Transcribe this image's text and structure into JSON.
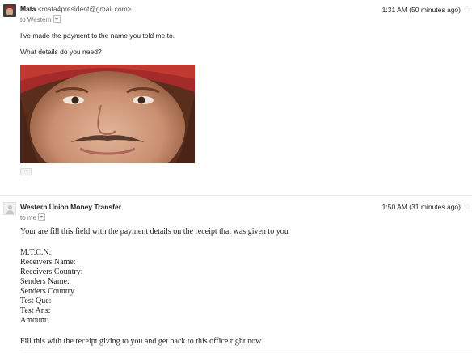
{
  "message1": {
    "sender_name": "Mata",
    "sender_email": "<mata4president@gmail.com>",
    "recipient": "to Western",
    "time": "1:31 AM (50 minutes ago)",
    "line1": "I've made the payment to the name you told me to.",
    "line2": "What details do you need?",
    "ellipsis": "···"
  },
  "message2": {
    "sender_name": "Western Union Money Transfer",
    "recipient": "to me",
    "time": "1:50 AM (31 minutes ago)",
    "intro": "Your are fill this field with the payment details on the receipt that was given to you",
    "fields": [
      "M.T.C.N:",
      "Receivers Name:",
      "Receivers Country:",
      "Senders Name:",
      "Senders Country",
      "Test Que:",
      "Test Ans:",
      "Amount:"
    ],
    "closing": "Fill this with the receipt giving to you and get back to this office right now"
  },
  "icons": {
    "star": "star-icon",
    "dropdown": "chevron-down-icon",
    "avatar_default": "person-icon"
  },
  "colors": {
    "star": "#d4d4d4",
    "meta_text": "#777777"
  }
}
